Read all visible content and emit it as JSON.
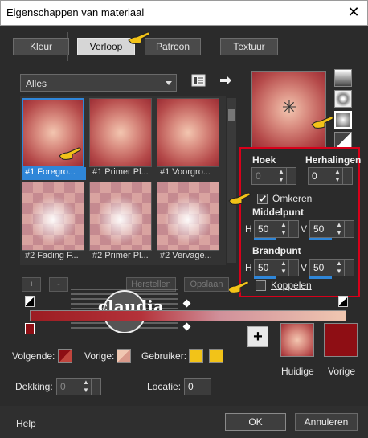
{
  "window": {
    "title": "Eigenschappen van materiaal",
    "close_glyph": "✕"
  },
  "tabs": [
    {
      "label": "Kleur",
      "active": false
    },
    {
      "label": "Verloop",
      "active": true
    },
    {
      "label": "Patroon",
      "active": false
    },
    {
      "label": "Textuur",
      "active": false
    }
  ],
  "library": {
    "dropdown_value": "Alles",
    "items": [
      {
        "caption": "#1 Foregro...",
        "style": "radial",
        "selected": true
      },
      {
        "caption": "#1 Primer Pl...",
        "style": "radial",
        "selected": false
      },
      {
        "caption": "#1 Voorgro...",
        "style": "radial",
        "selected": false
      },
      {
        "caption": "#2 Fading F...",
        "style": "checker",
        "selected": false
      },
      {
        "caption": "#2 Primer Pl...",
        "style": "checker",
        "selected": false
      },
      {
        "caption": "#2 Vervage...",
        "style": "checker",
        "selected": false
      }
    ]
  },
  "settings": {
    "angle_label": "Hoek",
    "angle_value": "0",
    "repeats_label": "Herhalingen",
    "repeats_value": "0",
    "invert_label": "Omkeren",
    "invert_checked": true,
    "midpoint_label": "Middelpunt",
    "mid_h_label": "H",
    "mid_h_value": "50",
    "mid_v_label": "V",
    "mid_v_value": "50",
    "focal_label": "Brandpunt",
    "focal_h_label": "H",
    "focal_h_value": "50",
    "focal_v_label": "V",
    "focal_v_value": "50",
    "link_label": "Koppelen",
    "link_checked": false
  },
  "editor": {
    "add_label": "+",
    "remove_label": "-",
    "reset_label": "Herstellen",
    "save_label": "Opslaan",
    "watermark_text": "claudia",
    "watermark_subtext": "claudia"
  },
  "bottom": {
    "next_label": "Volgende:",
    "prev_label": "Vorige:",
    "user_label": "Gebruiker:",
    "opacity_label": "Dekking:",
    "opacity_value": "0",
    "location_label": "Locatie:",
    "location_value": "0",
    "current_label": "Huidige",
    "previous_label": "Vorige",
    "plus_label": "+"
  },
  "footer": {
    "help_label": "Help",
    "ok_label": "OK",
    "cancel_label": "Annuleren"
  },
  "colors": {
    "accent": "#2f86d8",
    "highlight_frame": "#d8001a",
    "dark_red": "#8e0e14",
    "user_yellow": "#f2c318",
    "gradient_light": "#f0c7b1"
  },
  "icons": [
    "close-icon",
    "dropdown-arrow-icon",
    "library-icon",
    "arrow-right-icon",
    "pointing-hand-icon",
    "center-cross-icon",
    "checkmark-icon"
  ]
}
